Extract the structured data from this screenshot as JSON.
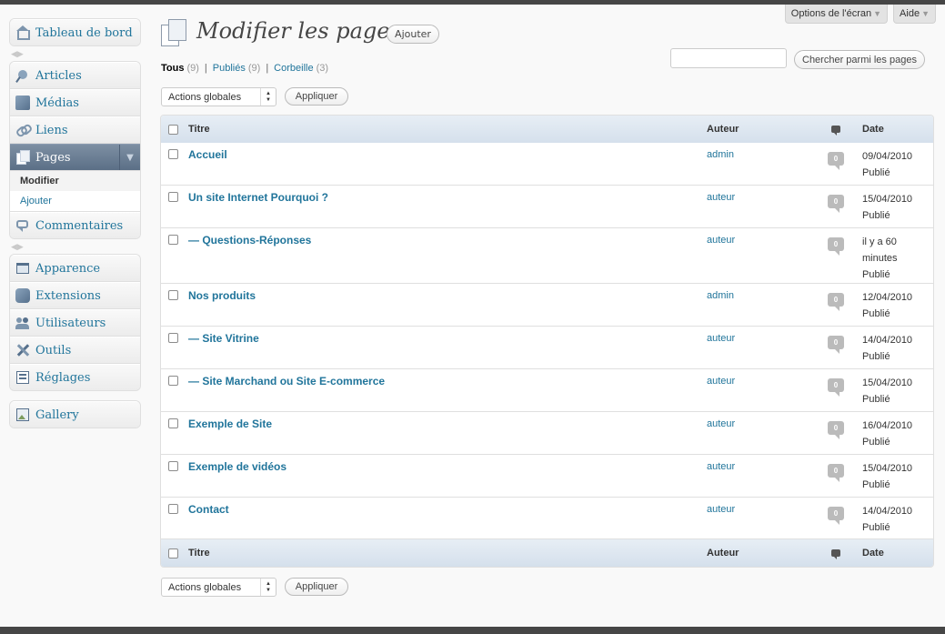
{
  "screen_options": {
    "options_label": "Options de l'écran",
    "help_label": "Aide"
  },
  "sidebar": {
    "dashboard": "Tableau de bord",
    "group1": [
      "Articles",
      "Médias",
      "Liens"
    ],
    "pages": {
      "label": "Pages",
      "sub_edit": "Modifier",
      "sub_add": "Ajouter"
    },
    "comments": "Commentaires",
    "group2": [
      "Apparence",
      "Extensions",
      "Utilisateurs",
      "Outils",
      "Réglages"
    ],
    "gallery": "Gallery"
  },
  "header": {
    "title": "Modifier les pages",
    "add_new": "Ajouter"
  },
  "filters": {
    "all": {
      "label": "Tous",
      "count": "(9)"
    },
    "published": {
      "label": "Publiés",
      "count": "(9)"
    },
    "trash": {
      "label": "Corbeille",
      "count": "(3)"
    }
  },
  "search": {
    "placeholder": "",
    "button": "Chercher parmi les pages"
  },
  "bulk": {
    "label": "Actions globales",
    "apply": "Appliquer"
  },
  "table": {
    "columns": {
      "title": "Titre",
      "author": "Auteur",
      "date": "Date"
    },
    "rows": [
      {
        "title": "Accueil",
        "author": "admin",
        "comments": "0",
        "date": "09/04/2010",
        "status": "Publié"
      },
      {
        "title": "Un site Internet Pourquoi ?",
        "author": "auteur",
        "comments": "0",
        "date": "15/04/2010",
        "status": "Publié"
      },
      {
        "title": "— Questions-Réponses",
        "author": "auteur",
        "comments": "0",
        "date": "il y a 60 minutes",
        "status": "Publié"
      },
      {
        "title": "Nos produits",
        "author": "admin",
        "comments": "0",
        "date": "12/04/2010",
        "status": "Publié"
      },
      {
        "title": "— Site Vitrine",
        "author": "auteur",
        "comments": "0",
        "date": "14/04/2010",
        "status": "Publié"
      },
      {
        "title": "— Site Marchand ou Site E-commerce",
        "author": "auteur",
        "comments": "0",
        "date": "15/04/2010",
        "status": "Publié"
      },
      {
        "title": "Exemple de Site",
        "author": "auteur",
        "comments": "0",
        "date": "16/04/2010",
        "status": "Publié"
      },
      {
        "title": "Exemple de vidéos",
        "author": "auteur",
        "comments": "0",
        "date": "15/04/2010",
        "status": "Publié"
      },
      {
        "title": "Contact",
        "author": "auteur",
        "comments": "0",
        "date": "14/04/2010",
        "status": "Publié"
      }
    ]
  },
  "colors": {
    "link": "#21759b",
    "header_bar": "#464646",
    "active_menu": "#5b6f86"
  }
}
